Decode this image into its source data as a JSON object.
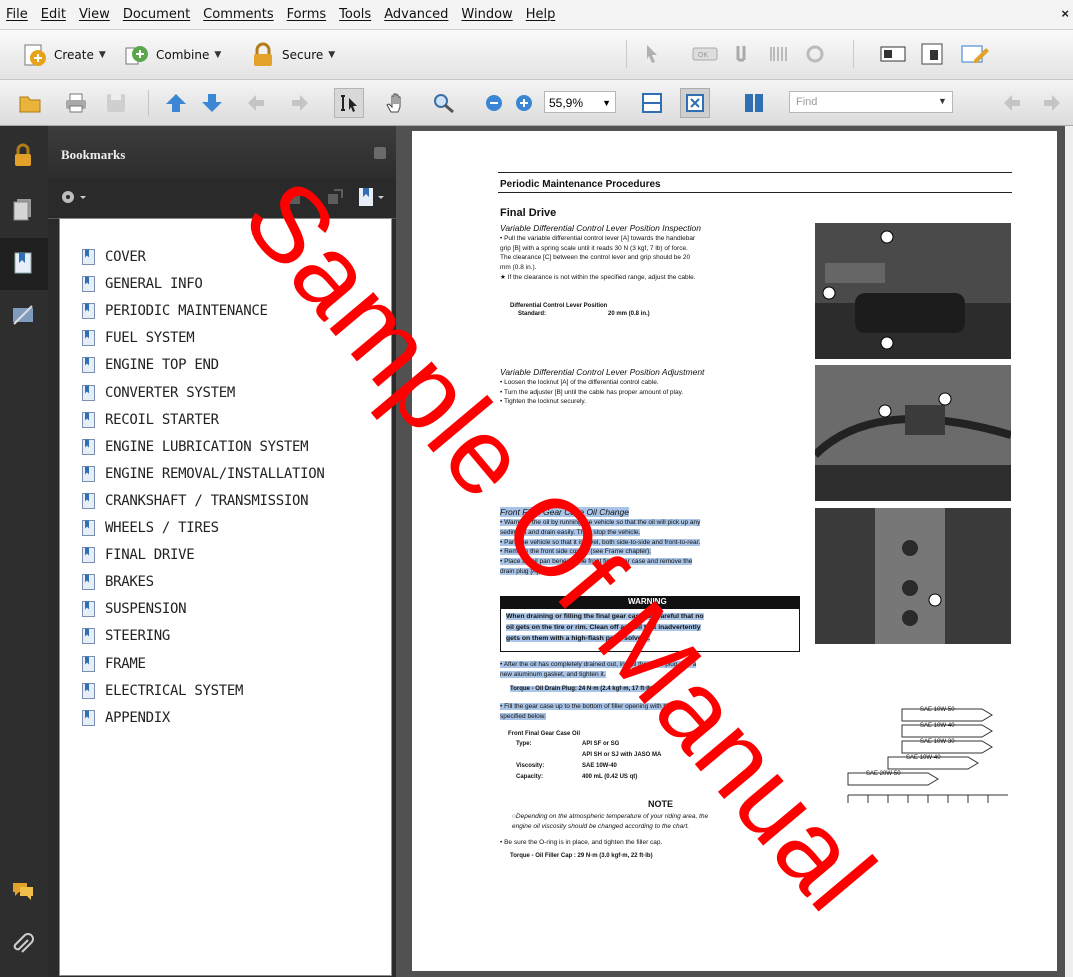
{
  "menu": [
    "File",
    "Edit",
    "View",
    "Document",
    "Comments",
    "Forms",
    "Tools",
    "Advanced",
    "Window",
    "Help"
  ],
  "menu_close": "×",
  "task_toolbar": {
    "create_label": "Create",
    "combine_label": "Combine",
    "secure_label": "Secure"
  },
  "nav_toolbar": {
    "zoom_value": "55,9%",
    "find_placeholder": "Find"
  },
  "bookmarks": {
    "title": "Bookmarks",
    "items": [
      "COVER",
      "GENERAL INFO",
      "PERIODIC MAINTENANCE",
      "FUEL SYSTEM",
      "ENGINE TOP END",
      "CONVERTER SYSTEM",
      "RECOIL STARTER",
      "ENGINE LUBRICATION SYSTEM",
      "ENGINE REMOVAL/INSTALLATION",
      "CRANKSHAFT / TRANSMISSION",
      "WHEELS / TIRES",
      "FINAL DRIVE",
      "BRAKES",
      "SUSPENSION",
      "STEERING",
      "FRAME",
      "ELECTRICAL SYSTEM",
      "APPENDIX"
    ]
  },
  "document": {
    "header": "Periodic Maintenance Procedures",
    "section": "Final Drive",
    "sub1": "Variable Differential Control Lever Position Inspection",
    "sub1_lines": [
      "• Pull the variable differential control lever [A] towards the handlebar",
      "grip [B] with a spring scale until it reads 30 N (3 kgf, 7 lb) of force.",
      "The clearance [C] between the control lever and grip should be 20",
      "mm (0.8 in.).",
      "★ If the clearance is not within the specified range, adjust the cable."
    ],
    "spec_title": "Differential Control Lever Position",
    "spec_label": "Standard:",
    "spec_value": "20 mm (0.8 in.)",
    "sub2": "Variable Differential Control Lever Position Adjustment",
    "sub2_lines": [
      "• Loosen the locknut [A] of the differential control cable.",
      "• Turn the adjuster [B] until the cable has proper amount of play.",
      "• Tighten the locknut securely."
    ],
    "sub3": "Front Final Gear Case Oil Change",
    "sub3_lines": [
      "• Warm up the oil by running the vehicle so that the oil will pick up any",
      "sediment and drain easily. Then stop the vehicle.",
      "• Park the vehicle so that it is level, both side-to-side and front-to-rear.",
      "• Remove the front side covers (see Frame chapter).",
      "• Place an oil pan beneath the front final gear case and remove the",
      "drain plug [A]."
    ],
    "warning_title": "WARNING",
    "warning_lines": [
      "When draining or filling the final gear case, be careful that no",
      "oil gets on the tire or rim. Clean off any oil that inadvertently",
      "gets on them with a high-flash point solvent."
    ],
    "after_lines": [
      "• After the oil has completely drained out, install the drain plug with a",
      "new aluminum gasket, and tighten it."
    ],
    "torque1": "Torque -   Oil Drain Plug: 24 N·m (2.4 kgf·m, 17 ft·lb)",
    "fill_lines": [
      "• Fill the gear case up to the bottom of filler opening with the oil",
      "specified below."
    ],
    "oil_title": "Front Final Gear Case Oil",
    "oil_rows": [
      [
        "Type:",
        "API SF or SG"
      ],
      [
        "",
        "API SH or SJ with JASO MA"
      ],
      [
        "Viscosity:",
        "SAE 10W-40"
      ],
      [
        "Capacity:",
        "400 mL (0.42 US qt)"
      ]
    ],
    "note_title": "NOTE",
    "note_lines": [
      "○Depending on the atmospheric temperature of your riding area, the",
      "engine oil viscosity should be changed according to the chart."
    ],
    "final_line": "• Be sure the O-ring is in place, and tighten the filler cap.",
    "torque2": "Torque -   Oil Filler Cap : 29 N·m (3.0 kgf·m, 22 ft·lb)",
    "visc_labels": [
      "SAE 10W-50",
      "SAE 10W-40",
      "SAE 10W-30",
      "SAE 10W-40",
      "SAE 20W-50"
    ]
  },
  "watermark": "Sample Of Manual"
}
